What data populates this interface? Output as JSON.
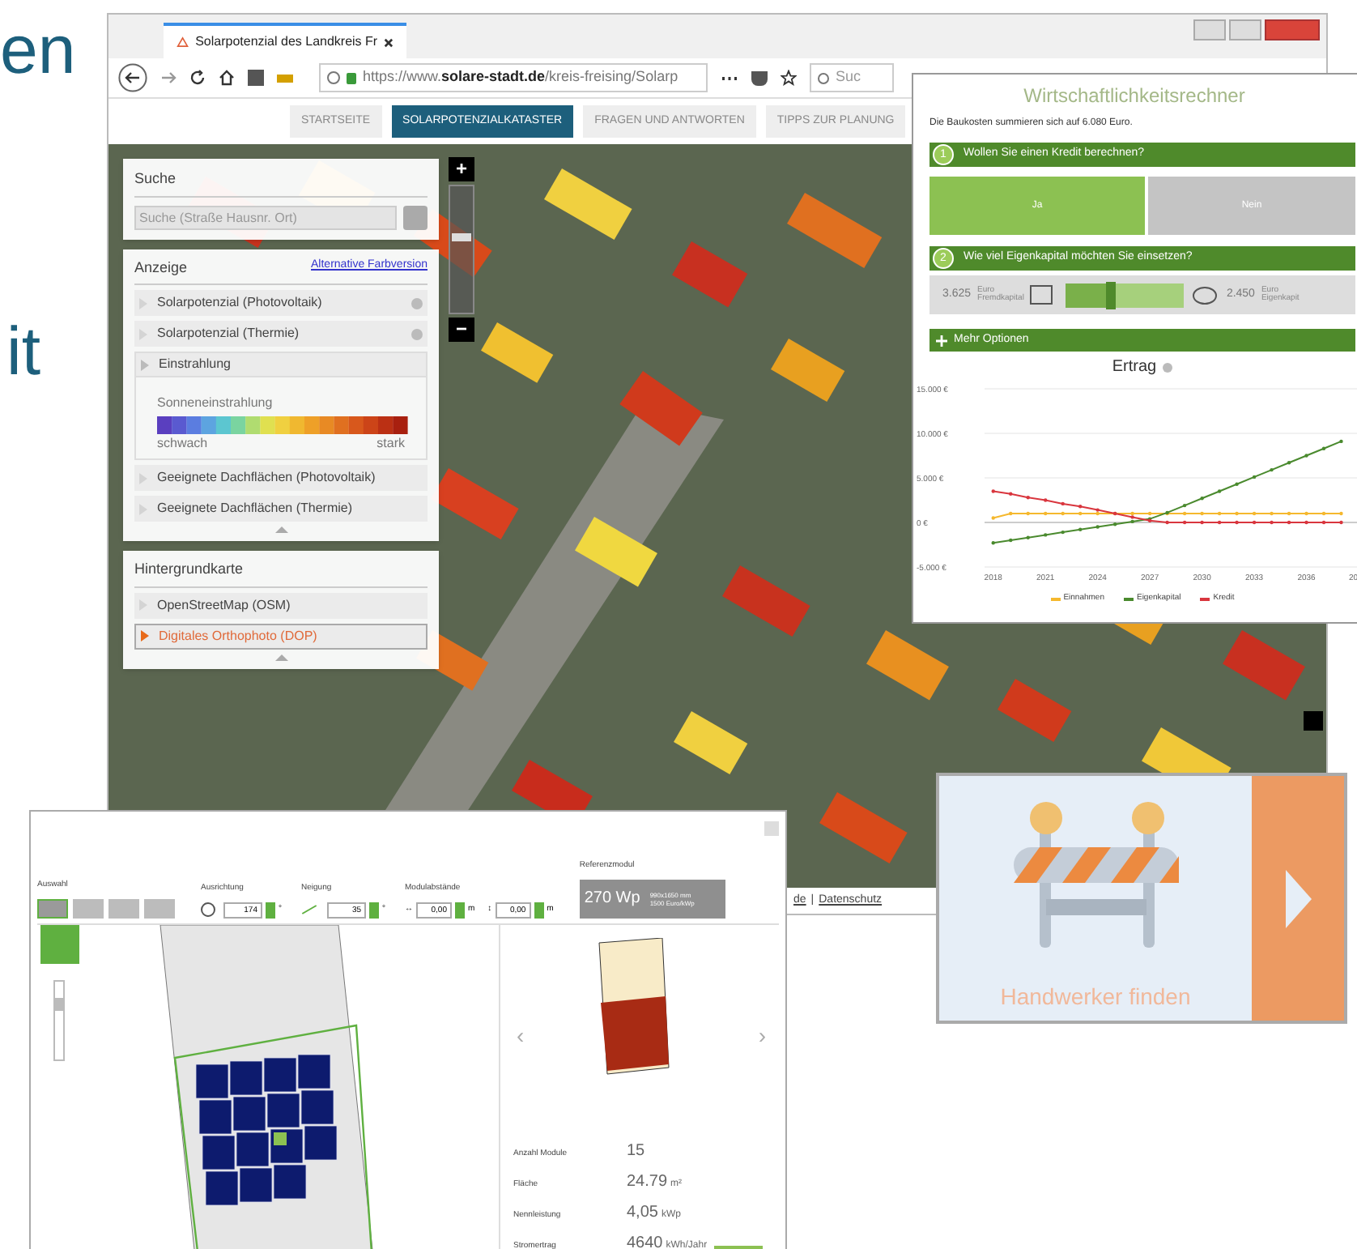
{
  "slide_text": [
    "en",
    "it"
  ],
  "browser": {
    "tab_title": "Solarpotenzial des Landkreis Fr",
    "url_prefix": "https://www.",
    "url_domain": "solare-stadt.de",
    "url_path": "/kreis-freising/Solarp",
    "search_placeholder": "Suc",
    "nav": [
      {
        "label": "STARTSEITE",
        "selected": false
      },
      {
        "label": "SOLARPOTENZIALKATASTER",
        "selected": true
      },
      {
        "label": "FRAGEN UND ANTWORTEN",
        "selected": false
      },
      {
        "label": "TIPPS ZUR PLANUNG",
        "selected": false
      }
    ],
    "zoom_in": "+",
    "zoom_out": "−",
    "zoom": {
      "level": 0.6
    },
    "footer": [
      "de",
      "|",
      "Datenschutz"
    ]
  },
  "sidebar": {
    "search_title": "Suche",
    "search_placeholder": "Suche (Straße Hausnr. Ort)",
    "display_title": "Anzeige",
    "display_link": "Alternative Farbversion",
    "layers": [
      {
        "label": "Solarpotenzial (Photovoltaik)",
        "expanded": false,
        "info": true
      },
      {
        "label": "Solarpotenzial (Thermie)",
        "expanded": false,
        "info": true
      },
      {
        "label": "Einstrahlung",
        "expanded": true,
        "info": false
      },
      {
        "label": "Geeignete Dachflächen (Photovoltaik)",
        "expanded": false,
        "info": false
      },
      {
        "label": "Geeignete Dachflächen (Thermie)",
        "expanded": false,
        "info": false
      }
    ],
    "legend": {
      "title": "Sonneneinstrahlung",
      "low": "schwach",
      "high": "stark"
    },
    "basemap_title": "Hintergrundkarte",
    "basemaps": [
      {
        "label": "OpenStreetMap (OSM)",
        "selected": false
      },
      {
        "label": "Digitales Orthophoto (DOP)",
        "selected": true
      }
    ]
  },
  "calculator": {
    "title": "Wirtschaftlichkeitsrechner",
    "intro": "Die Baukosten summieren sich auf 6.080 Euro.",
    "steps": [
      {
        "number": "1",
        "question": "Wollen Sie einen Kredit berechnen?"
      },
      {
        "number": "2",
        "question": "Wie viel Eigenkapital möchten Sie einsetzen?"
      }
    ],
    "choices": [
      {
        "label": "Ja",
        "selected": true
      },
      {
        "label": "Nein",
        "selected": false
      }
    ],
    "equity": {
      "loan_value": "3.625",
      "loan_unit": "Euro",
      "loan_label": "Fremdkapital",
      "equity_value": "2.450",
      "equity_unit": "Euro",
      "equity_label": "Eigenkapit",
      "level": 0.38
    },
    "more_options": "Mehr Optionen",
    "chart_data": {
      "type": "line",
      "title": "Ertrag",
      "x": [
        2018,
        2019,
        2020,
        2021,
        2022,
        2023,
        2024,
        2025,
        2026,
        2027,
        2028,
        2029,
        2030,
        2031,
        2032,
        2033,
        2034,
        2035,
        2036,
        2037,
        2038
      ],
      "series": [
        {
          "name": "Einnahmen",
          "color": "#f5b82e",
          "values": [
            500,
            1000,
            1000,
            1000,
            1000,
            1000,
            1000,
            1000,
            1000,
            1000,
            1000,
            1000,
            1000,
            1000,
            1000,
            1000,
            1000,
            1000,
            1000,
            1000,
            1000
          ]
        },
        {
          "name": "Eigenkapital",
          "color": "#4a8a2e",
          "values": [
            -2300,
            -2000,
            -1700,
            -1400,
            -1100,
            -800,
            -500,
            -200,
            100,
            400,
            1100,
            1900,
            2700,
            3500,
            4300,
            5100,
            5900,
            6700,
            7500,
            8300,
            9100
          ]
        },
        {
          "name": "Kredit",
          "color": "#d9363e",
          "values": [
            3500,
            3200,
            2800,
            2500,
            2100,
            1800,
            1400,
            1000,
            600,
            200,
            0,
            0,
            0,
            0,
            0,
            0,
            0,
            0,
            0,
            0,
            0
          ]
        }
      ],
      "xlim": [
        2017.5,
        2039
      ],
      "ylim": [
        -5000,
        15000
      ],
      "yticks": [
        {
          "value": 15000,
          "label": "15.000 €"
        },
        {
          "value": 10000,
          "label": "10.000 €"
        },
        {
          "value": 5000,
          "label": "5.000 €"
        },
        {
          "value": 0,
          "label": "0 €"
        },
        {
          "value": -5000,
          "label": "-5.000 €"
        }
      ],
      "xticks": [
        2018,
        2021,
        2024,
        2027,
        2030,
        2033,
        2036
      ],
      "legend": "bottom"
    },
    "cut_axis_label": "20"
  },
  "planner": {
    "selection": "Auswahl",
    "tools": [
      {
        "selected": true
      },
      {
        "selected": false
      },
      {
        "selected": false
      },
      {
        "selected": false
      }
    ],
    "zoom": {
      "level": 0.75
    },
    "orientation": "Ausrichtung",
    "orientation_value": "174",
    "orientation_unit": "°",
    "tilt": "Neigung",
    "tilt_value": "35",
    "tilt_unit": "°",
    "spacing": "Modulabstände",
    "spacing_h": "0,00",
    "spacing_h_unit": "m",
    "spacing_v": "0,00",
    "spacing_v_unit": "m",
    "spacing_h_sign": "↔",
    "spacing_v_sign": "↕",
    "reference_title": "Referenzmodul",
    "reference_power": "270 Wp",
    "reference_size": "990x1650 mm",
    "reference_price": "1500 Euro/kWp",
    "prev": "‹",
    "next": "›",
    "stats": [
      {
        "label": "Anzahl Module",
        "value": "15"
      },
      {
        "label": "Fläche",
        "value": "24.79",
        "unit": "m²"
      },
      {
        "label": "Nennleistung",
        "value": "4,05",
        "unit": "kWp"
      },
      {
        "label": "Stromertrag",
        "value": "4640",
        "unit": "kWh/Jahr"
      }
    ]
  },
  "craftsman": {
    "label": "Handwerker finden"
  }
}
